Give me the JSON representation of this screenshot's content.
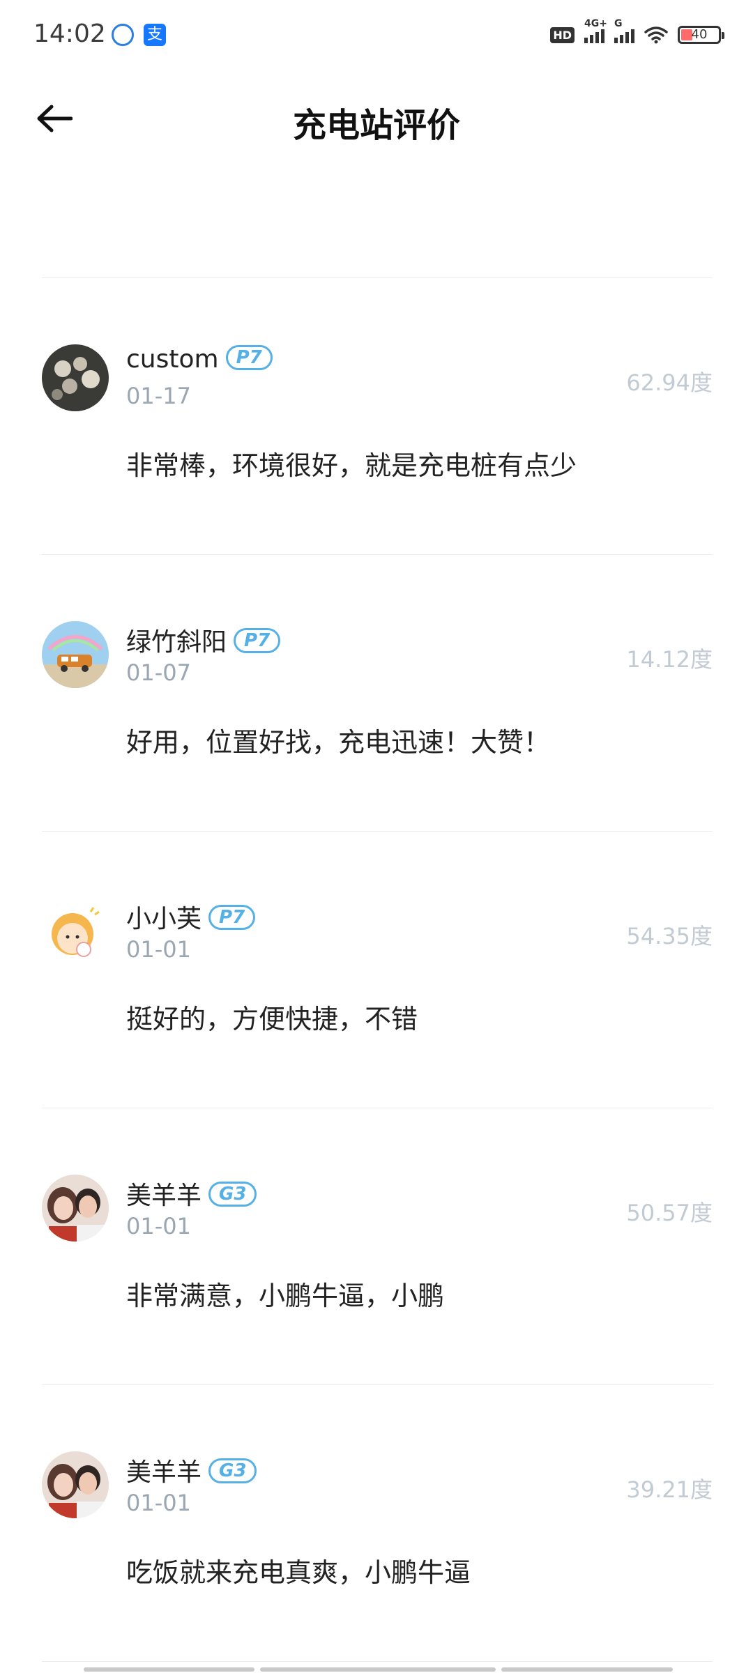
{
  "status_bar": {
    "time": "14:02",
    "battery": "40",
    "network_1": "4G+",
    "network_2": "G",
    "hd": "HD"
  },
  "header": {
    "title": "充电站评价",
    "back_icon": "arrow-left-icon"
  },
  "reviews": [
    {
      "name": "custom",
      "badge": "P7",
      "date": "01-17",
      "energy": "62.94度",
      "text": "非常棒，环境很好，就是充电桩有点少"
    },
    {
      "name": "绿竹斜阳",
      "badge": "P7",
      "date": "01-07",
      "energy": "14.12度",
      "text": "好用，位置好找，充电迅速！大赞！"
    },
    {
      "name": "小小芙",
      "badge": "P7",
      "date": "01-01",
      "energy": "54.35度",
      "text": "挺好的，方便快捷，不错"
    },
    {
      "name": "美羊羊",
      "badge": "G3",
      "date": "01-01",
      "energy": "50.57度",
      "text": "非常满意，小鹏牛逼，小鹏"
    },
    {
      "name": "美羊羊",
      "badge": "G3",
      "date": "01-01",
      "energy": "39.21度",
      "text": "吃饭就来充电真爽，小鹏牛逼"
    }
  ]
}
